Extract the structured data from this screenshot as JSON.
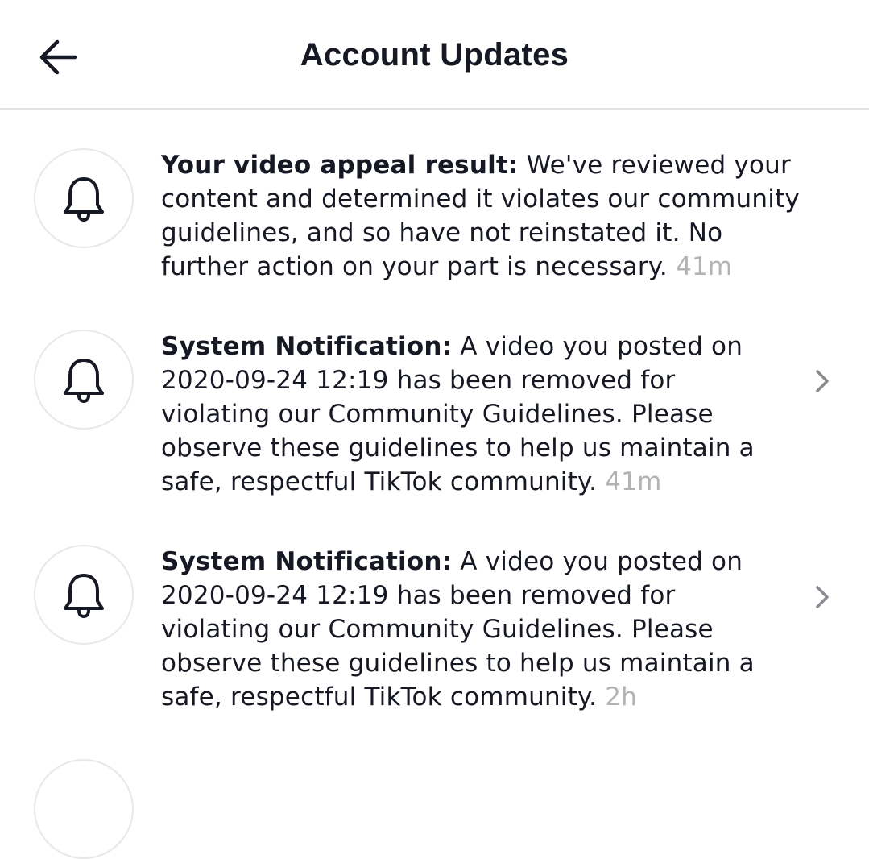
{
  "header": {
    "title": "Account Updates",
    "back_icon": "arrow-left-icon"
  },
  "notifications": [
    {
      "icon": "bell-icon",
      "heading": "Your video appeal result:",
      "body": " We've reviewed your content and determined it violates our community guidelines, and so have not reinstated it. No further action on your part is necessary.",
      "time": "41m",
      "has_chevron": false
    },
    {
      "icon": "bell-icon",
      "heading": "System Notification:",
      "body": " A video you posted on 2020-09-24 12:19 has been removed for violating our Community Guidelines. Please observe these guidelines to help us maintain a safe, respectful TikTok community.",
      "time": "41m",
      "has_chevron": true
    },
    {
      "icon": "bell-icon",
      "heading": "System Notification:",
      "body": " A video you posted on 2020-09-24 12:19 has been removed for violating our Community Guidelines. Please observe these guidelines to help us maintain a safe, respectful TikTok community.",
      "time": "2h",
      "has_chevron": true
    }
  ],
  "colors": {
    "text": "#161823",
    "timestamp": "#b3b3b6",
    "divider": "#e3e3e4",
    "avatar_border": "#e8e8e8",
    "chevron": "#8a8b91"
  }
}
